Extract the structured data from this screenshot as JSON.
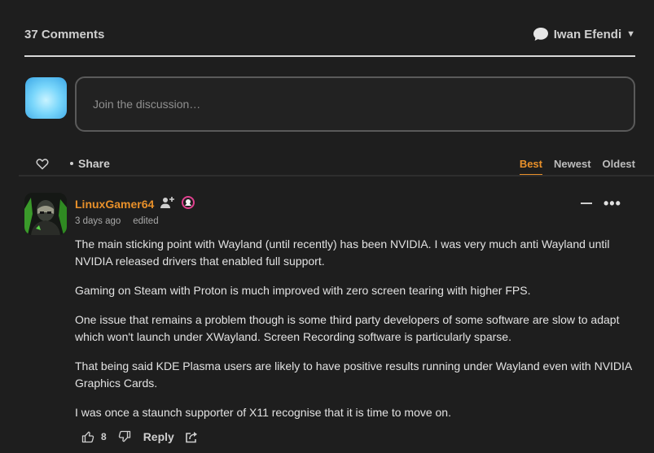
{
  "header": {
    "comment_count": "37 Comments",
    "user_name": "Iwan Efendi"
  },
  "composer": {
    "placeholder": "Join the discussion…"
  },
  "toolbar": {
    "share_label": "Share",
    "sort_options": [
      "Best",
      "Newest",
      "Oldest"
    ],
    "active_sort": "Best"
  },
  "comment": {
    "author": "LinuxGamer64",
    "time": "3 days ago",
    "edited_label": "edited",
    "paragraphs": [
      "The main sticking point with Wayland (until recently) has been NVIDIA. I was very much anti Wayland until NVIDIA released drivers that enabled full support.",
      "Gaming on Steam with Proton is much improved with zero screen tearing with higher FPS.",
      "One issue that remains a problem though is some third party developers of some software are slow to adapt which won't launch under XWayland. Screen Recording software is particularly sparse.",
      "That being said KDE Plasma users are likely to have positive results running under Wayland even with NVIDIA Graphics Cards.",
      "I was once a staunch supporter of X11 recognise that it is time to move on."
    ],
    "upvotes": "8",
    "reply_label": "Reply",
    "more_label": "•••"
  },
  "colors": {
    "background": "#1e1e1e",
    "accent": "#e8902a",
    "text": "#e2e2e2",
    "muted": "#a9a9a9",
    "badge_pink": "#e0418f"
  },
  "icons": [
    "chat-bubble-icon",
    "chevron-down-icon",
    "heart-icon",
    "add-user-icon",
    "badge-icon",
    "collapse-icon",
    "more-icon",
    "thumbs-up-icon",
    "thumbs-down-icon",
    "share-icon"
  ]
}
